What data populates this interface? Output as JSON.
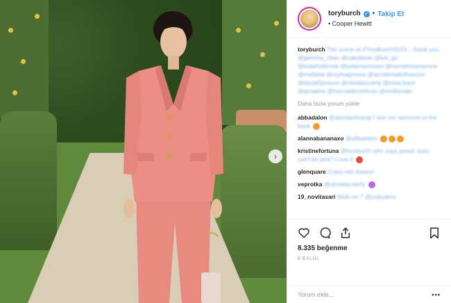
{
  "header": {
    "username": "toryburch",
    "verified_icon": "verified-badge-icon",
    "separator": "•",
    "follow_label": "Takip Et",
    "location_prefix": "•",
    "location": "Cooper Hewitt"
  },
  "caption": {
    "username": "toryburch",
    "text": "The scene at #ToryBurchSS19... thank you @gemma_chan @cakebede @kat_go @katieholbrook @juliannemoore @harrietrosenerene @mafalda @ciymagreece @accidentalinfluencer @doubl3posure @oliviatacuerly @luisa.baye @ipmalina @hannahbronfman @emilisnder"
  },
  "more_comments_label": "Daha fazla yorum yükle",
  "comments": [
    {
      "user": "abbadalon",
      "text": "@atoniaminangi I see our sunroom in the back",
      "emoji": [
        "orange"
      ]
    },
    {
      "user": "alannabananaxo",
      "text": "@albadalon",
      "emoji": [
        "orange",
        "orange",
        "orange"
      ]
    },
    {
      "user": "kristinefortuna",
      "text": "@toryburch who says power suits can't be pink? Love it",
      "emoji": [
        "heart"
      ]
    },
    {
      "user": "glenquare",
      "text": "Crazy rich Asians!",
      "emoji": []
    },
    {
      "user": "veprotka",
      "text": "@oliviataculerly",
      "emoji": [
        "purple"
      ]
    },
    {
      "user": "19_novitasari",
      "text": "Slide no 7 @yopiyama",
      "emoji": []
    }
  ],
  "actions": {
    "like_icon": "heart-icon",
    "comment_icon": "comment-icon",
    "share_icon": "share-icon",
    "save_icon": "bookmark-icon",
    "likes": "8.335 beğenme",
    "date": "8 EYLÜL"
  },
  "add_comment": {
    "placeholder": "Yorum ekle...",
    "more_label": "•••"
  },
  "media": {
    "next_icon": "chevron-right-icon",
    "next_glyph": "›"
  },
  "colors": {
    "accent": "#3897f0",
    "suit": "#ec8c84",
    "hedge": "#2b4a1d"
  }
}
